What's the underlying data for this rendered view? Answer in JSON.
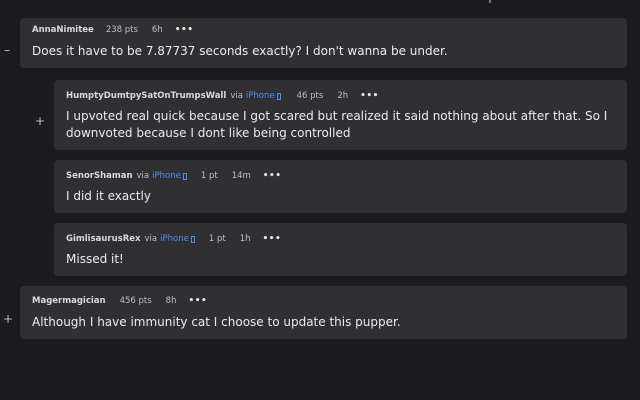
{
  "comments": [
    {
      "author": "AnnaNimitee",
      "via": "",
      "device": "",
      "points": "238 pts",
      "age": "6h",
      "more": "•••",
      "toggle": "–",
      "text": "Does it have to be 7.87737 seconds exactly? I don't wanna be under."
    },
    {
      "author": "HumptyDumtpySatOnTrumpsWall",
      "via": "via",
      "device": "iPhone",
      "points": "46 pts",
      "age": "2h",
      "more": "•••",
      "toggle": "+",
      "text": "I upvoted real quick because I got scared but realized it said nothing about after that. So I downvoted because I dont like being controlled"
    },
    {
      "author": "SenorShaman",
      "via": "via",
      "device": "iPhone",
      "points": "1 pt",
      "age": "14m",
      "more": "•••",
      "toggle": "",
      "text": "I did it exactly"
    },
    {
      "author": "GimlisaurusRex",
      "via": "via",
      "device": "iPhone",
      "points": "1 pt",
      "age": "1h",
      "more": "•••",
      "toggle": "",
      "text": "Missed it!"
    },
    {
      "author": "Magermagician",
      "via": "",
      "device": "",
      "points": "456 pts",
      "age": "8h",
      "more": "•••",
      "toggle": "+",
      "text": "Although I have immunity cat I choose to update this pupper."
    }
  ]
}
